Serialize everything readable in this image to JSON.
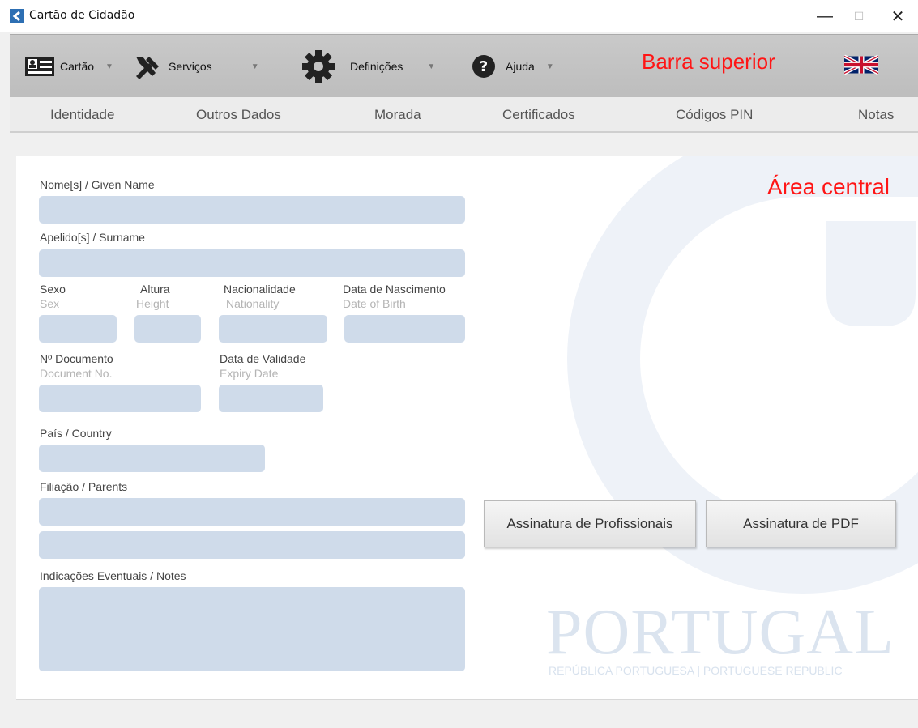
{
  "window": {
    "title": "Cartão de Cidadão",
    "min": "—",
    "max": "☐",
    "close": "✕"
  },
  "topbar": {
    "menus": [
      {
        "label": "Cartão",
        "icon": "id-card-icon"
      },
      {
        "label": "Serviços",
        "icon": "tools-icon"
      },
      {
        "label": "Definições",
        "icon": "gear-icon"
      },
      {
        "label": "Ajuda",
        "icon": "help-icon"
      }
    ],
    "label": "Barra superior",
    "language_icon": "uk-flag-icon"
  },
  "tabs": [
    "Identidade",
    "Outros Dados",
    "Morada",
    "Certificados",
    "Códigos PIN",
    "Notas"
  ],
  "central": {
    "label": "Área central",
    "fields": {
      "given_name": {
        "label": "Nome[s] / Given Name",
        "value": ""
      },
      "surname": {
        "label": "Apelido[s] / Surname",
        "value": ""
      },
      "sex": {
        "label": "Sexo",
        "sub": "Sex",
        "value": ""
      },
      "height": {
        "label": "Altura",
        "sub": "Height",
        "value": ""
      },
      "nationality": {
        "label": "Nacionalidade",
        "sub": "Nationality",
        "value": ""
      },
      "birth": {
        "label": "Data de Nascimento",
        "sub": "Date of Birth",
        "value": ""
      },
      "doc_no": {
        "label": "Nº Documento",
        "sub": "Document No.",
        "value": ""
      },
      "expiry": {
        "label": "Data de Validade",
        "sub": "Expiry Date",
        "value": ""
      },
      "country": {
        "label": "País / Country",
        "value": ""
      },
      "parents": {
        "label": "Filiação / Parents",
        "value1": "",
        "value2": ""
      },
      "notes": {
        "label": "Indicações Eventuais / Notes",
        "value": ""
      }
    },
    "buttons": {
      "prof_sign": "Assinatura de Profissionais",
      "pdf_sign": "Assinatura de PDF"
    },
    "watermark": {
      "title": "PORTUGAL",
      "subtitle": "REPÚBLICA PORTUGUESA | PORTUGUESE REPUBLIC"
    }
  },
  "colors": {
    "field": "#cfdbea",
    "accent_label": "#ff1515",
    "watermark": "#dbe4ef"
  }
}
